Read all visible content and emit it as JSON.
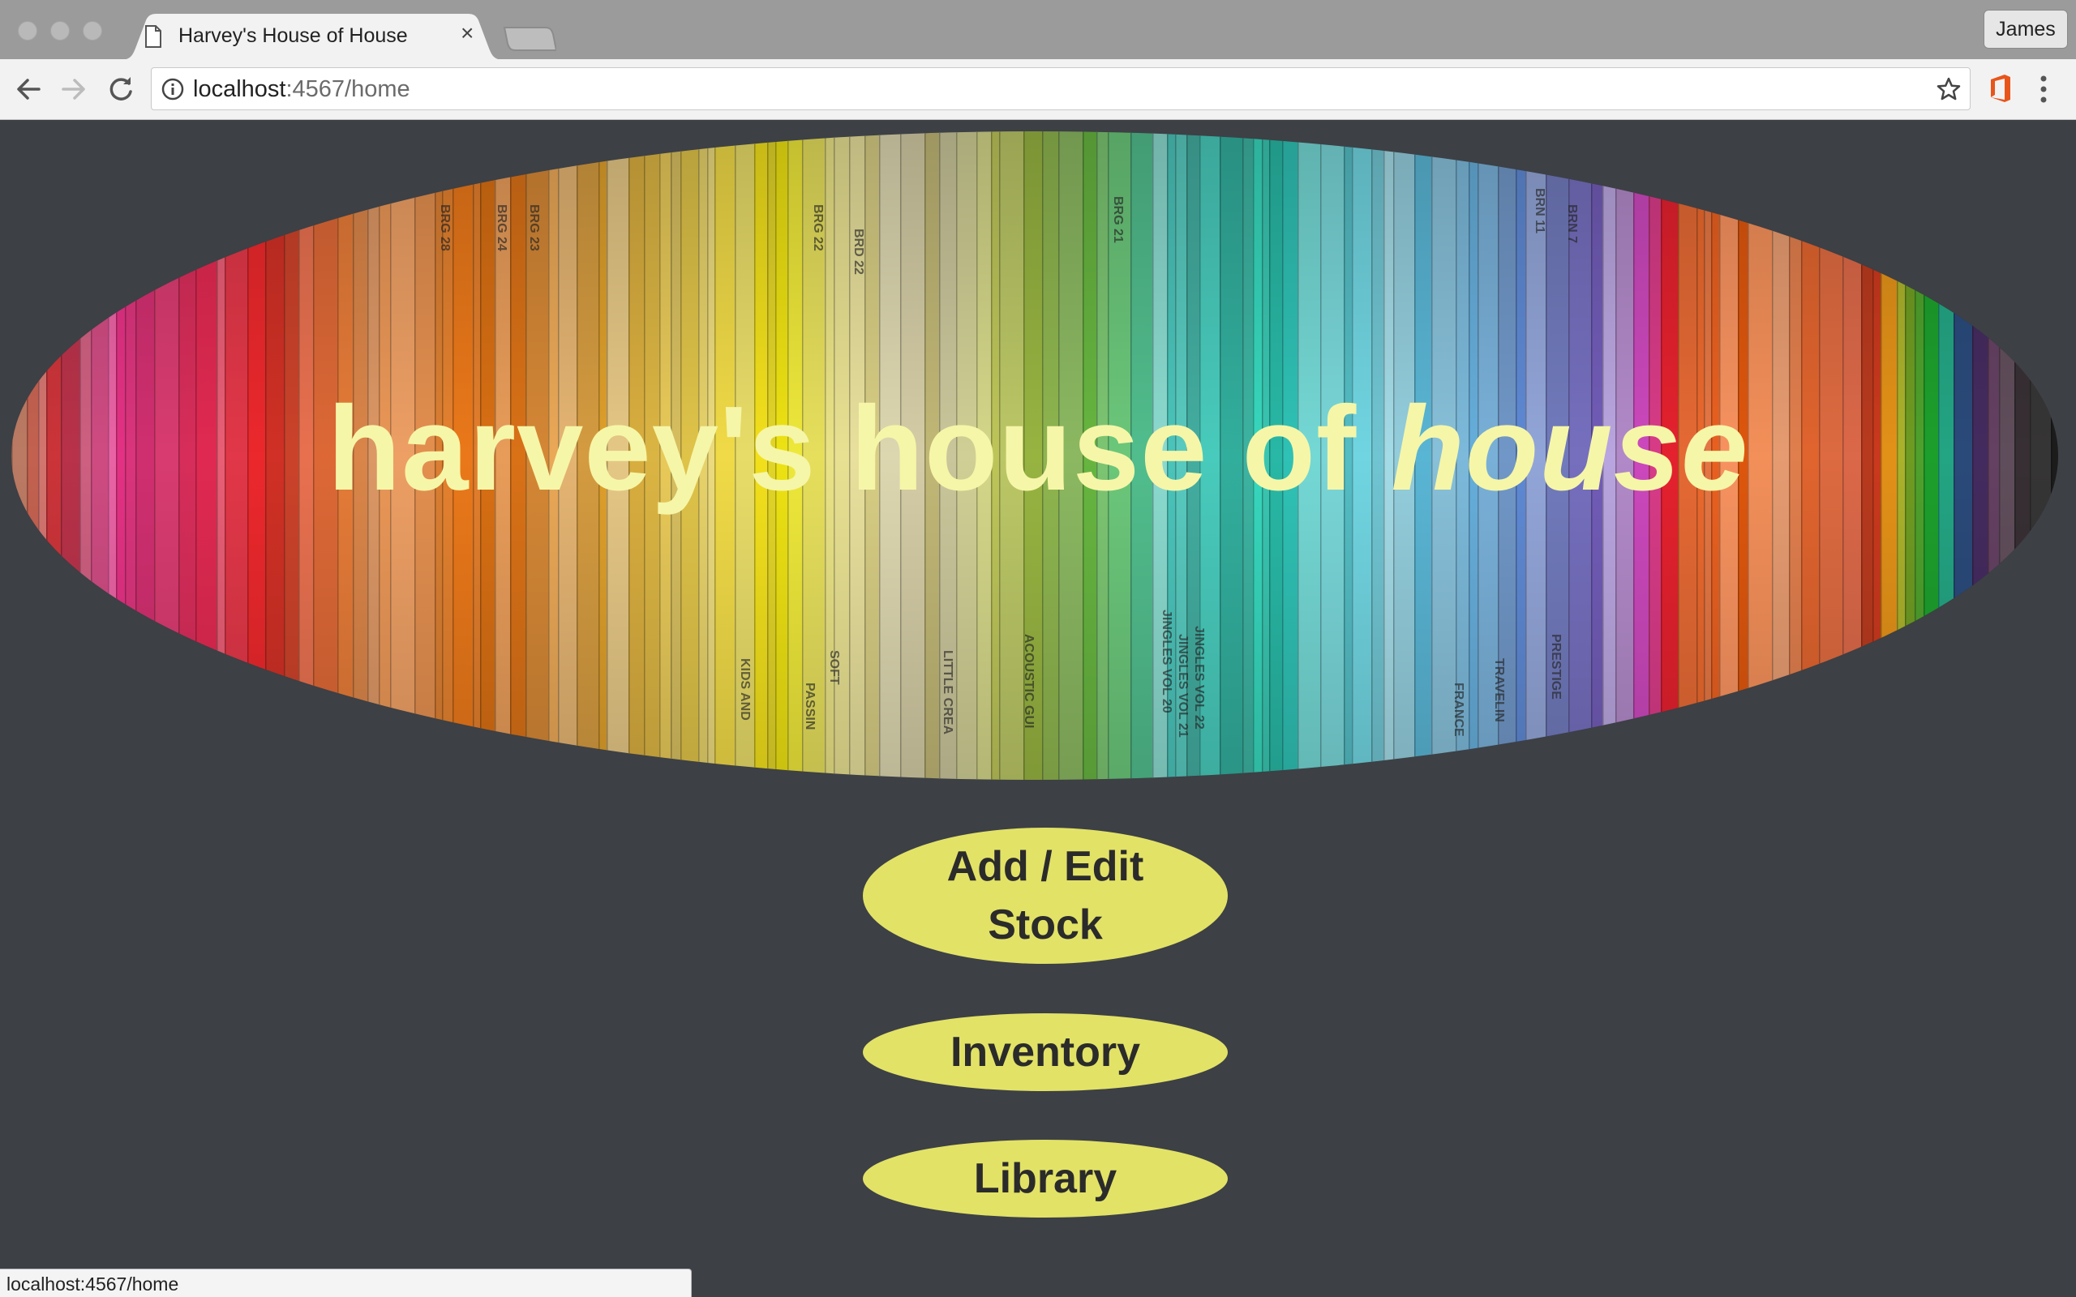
{
  "browser": {
    "tab_title": "Harvey's House of House",
    "profile_name": "James",
    "url_host": "localhost",
    "url_rest": ":4567/home",
    "status_url": "localhost:4567/home"
  },
  "page": {
    "hero_title_plain": "harvey's house of ",
    "hero_title_italic": "house",
    "buttons": {
      "add_edit_line1": "Add / Edit",
      "add_edit_line2": "Stock",
      "inventory": "Inventory",
      "library": "Library"
    }
  },
  "hero_spine_labels": [
    "BRG 28",
    "BRG 24",
    "BRG 23",
    "BRG 22",
    "BRD 22",
    "BRG 21",
    "BRN 11",
    "BRN 7",
    "JINGLES VOL 20",
    "JINGLES VOL 21",
    "JINGLES VOL 22",
    "ACOUSTIC GUI",
    "PRESTIGE",
    "TRAVELIN",
    "LITTLE CREA",
    "FRANCE",
    "KIDS AND",
    "PASSIN",
    "SOFT"
  ],
  "colors": {
    "page_bg": "#3d4045",
    "button_bg": "#e2e267",
    "button_text": "#2b2b2b",
    "hero_title": "#f6f6a8"
  },
  "icons": [
    "file-icon",
    "close-icon",
    "back-arrow-icon",
    "forward-arrow-icon",
    "reload-icon",
    "info-icon",
    "star-icon",
    "office-icon",
    "menu-dots-icon"
  ]
}
